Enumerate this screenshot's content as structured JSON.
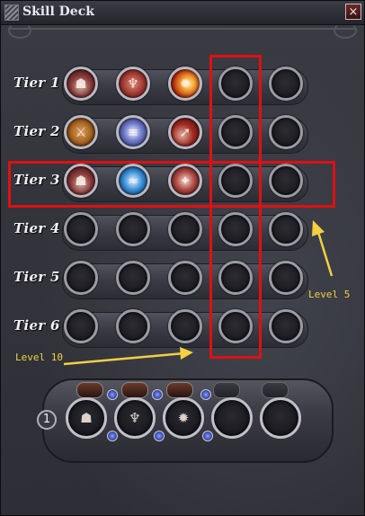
{
  "window": {
    "title": "Skill Deck",
    "close_label": "×"
  },
  "tiers": [
    {
      "label": "Tier 1",
      "slots": [
        "hood-icon",
        "torso-icon",
        "fire-burst-icon",
        "",
        ""
      ]
    },
    {
      "label": "Tier 2",
      "slots": [
        "axe-icon",
        "blades-icon",
        "arrow-icon",
        "",
        ""
      ]
    },
    {
      "label": "Tier 3",
      "slots": [
        "hood-icon",
        "wave-icon",
        "beast-icon",
        "",
        ""
      ]
    },
    {
      "label": "Tier 4",
      "slots": [
        "",
        "",
        "",
        "",
        ""
      ]
    },
    {
      "label": "Tier 5",
      "slots": [
        "",
        "",
        "",
        "",
        ""
      ]
    },
    {
      "label": "Tier 6",
      "slots": [
        "",
        "",
        "",
        "",
        ""
      ]
    }
  ],
  "annotations": {
    "level_5": "Level 5",
    "level_10": "Level 10"
  },
  "hotbar": {
    "number": "1",
    "slots": [
      "hood-icon",
      "torso-icon",
      "fire-burst-icon",
      "",
      ""
    ]
  },
  "colors": {
    "highlight": "#e01010",
    "annotation": "#f2d040"
  }
}
